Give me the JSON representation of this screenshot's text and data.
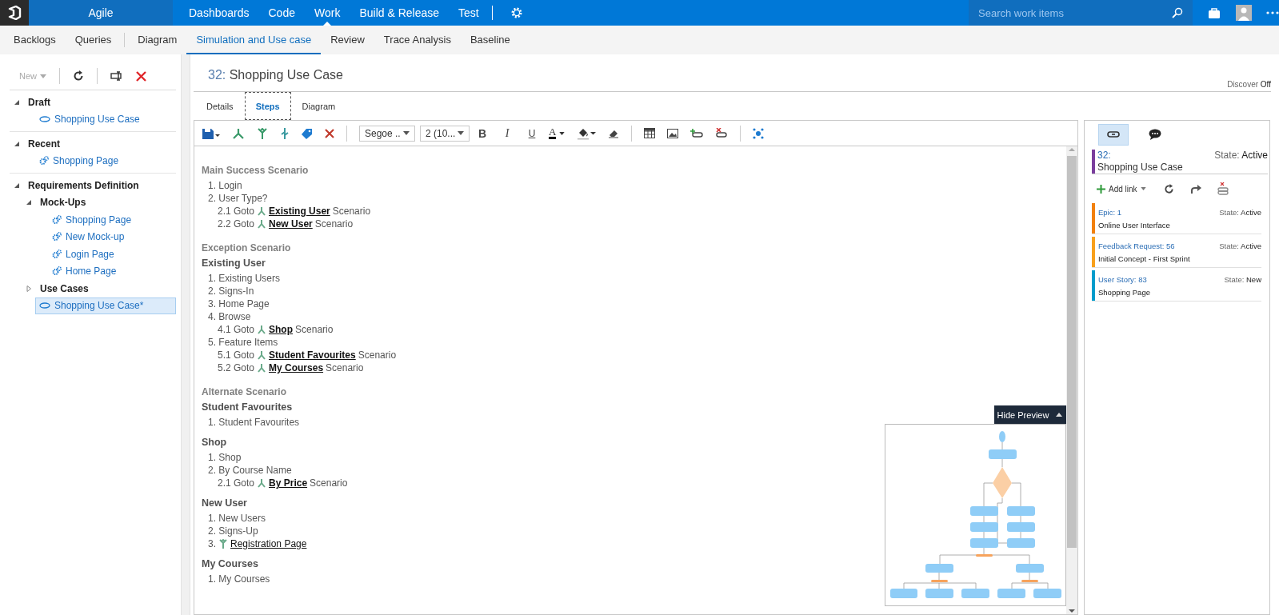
{
  "top_nav": {
    "project": "Agile",
    "items": [
      {
        "label": "Dashboards",
        "selected": false
      },
      {
        "label": "Code",
        "selected": false
      },
      {
        "label": "Work",
        "selected": true
      },
      {
        "label": "Build & Release",
        "selected": false
      },
      {
        "label": "Test",
        "selected": false
      }
    ],
    "search": {
      "placeholder": "Search work items"
    }
  },
  "sub_nav": {
    "items": [
      {
        "label": "Backlogs",
        "selected": false,
        "divider_after": false
      },
      {
        "label": "Queries",
        "selected": false,
        "divider_after": true
      },
      {
        "label": "Diagram",
        "selected": false,
        "divider_after": false
      },
      {
        "label": "Simulation and Use case",
        "selected": true,
        "divider_after": false
      },
      {
        "label": "Review",
        "selected": false,
        "divider_after": false
      },
      {
        "label": "Trace Analysis",
        "selected": false,
        "divider_after": false
      },
      {
        "label": "Baseline",
        "selected": false,
        "divider_after": false
      }
    ]
  },
  "explorer": {
    "new_button": {
      "label": "New",
      "disabled": true
    },
    "tree": [
      {
        "label": "Draft",
        "expanded": true,
        "children": [
          {
            "kind": "use-case",
            "label": "Shopping Use Case",
            "selected": false
          }
        ]
      },
      {
        "label": "Recent",
        "expanded": true,
        "children": [
          {
            "kind": "mockup",
            "label": "Shopping Page",
            "selected": false
          }
        ]
      },
      {
        "label": "Requirements Definition",
        "expanded": true,
        "children": [
          {
            "kind": "folder",
            "label": "Mock-Ups",
            "expanded": true,
            "children": [
              {
                "kind": "mockup",
                "label": "Shopping Page",
                "selected": false
              },
              {
                "kind": "mockup",
                "label": "New Mock-up",
                "selected": false
              },
              {
                "kind": "mockup",
                "label": "Login Page",
                "selected": false
              },
              {
                "kind": "mockup",
                "label": "Home Page",
                "selected": false
              }
            ]
          },
          {
            "kind": "folder",
            "label": "Use Cases",
            "expanded": false
          },
          {
            "kind": "use-case",
            "label": "Shopping Use Case*",
            "selected": true
          }
        ]
      }
    ]
  },
  "work_item": {
    "id": "32:",
    "title": "Shopping Use Case",
    "discover": {
      "label": "Discover",
      "value": "Off"
    },
    "tabs": [
      {
        "label": "Details",
        "selected": false
      },
      {
        "label": "Steps",
        "selected": true
      },
      {
        "label": "Diagram",
        "selected": false
      }
    ]
  },
  "editor": {
    "font": "Segoe ..",
    "size": "2 (10...",
    "format_buttons": [
      "B",
      "I",
      "U"
    ],
    "font_color": "A",
    "document": [
      {
        "kind": "section",
        "text": "Main Success Scenario"
      },
      {
        "kind": "step",
        "number": "1.",
        "text": "Login"
      },
      {
        "kind": "step",
        "number": "2.",
        "text": "User Type?"
      },
      {
        "kind": "goto",
        "number": "2.1",
        "prefix": "Goto",
        "link": "Existing User",
        "suffix": "Scenario"
      },
      {
        "kind": "goto",
        "number": "2.2",
        "prefix": "Goto",
        "link": "New User",
        "suffix": "Scenario"
      },
      {
        "kind": "section",
        "text": "Exception Scenario"
      },
      {
        "kind": "title",
        "text": "Existing User"
      },
      {
        "kind": "step",
        "number": "1.",
        "text": "Existing Users"
      },
      {
        "kind": "step",
        "number": "2.",
        "text": "Signs-In"
      },
      {
        "kind": "step",
        "number": "3.",
        "text": "Home Page"
      },
      {
        "kind": "step",
        "number": "4.",
        "text": "Browse"
      },
      {
        "kind": "goto",
        "number": "4.1",
        "prefix": "Goto",
        "link": "Shop",
        "suffix": "Scenario"
      },
      {
        "kind": "step",
        "number": "5.",
        "text": "Feature Items"
      },
      {
        "kind": "goto",
        "number": "5.1",
        "prefix": "Goto",
        "link": "Student Favourites",
        "suffix": "Scenario"
      },
      {
        "kind": "goto",
        "number": "5.2",
        "prefix": "Goto",
        "link": "My Courses",
        "suffix": "Scenario"
      },
      {
        "kind": "section",
        "text": "Alternate Scenario"
      },
      {
        "kind": "title",
        "text": "Student Favourites"
      },
      {
        "kind": "step",
        "number": "1.",
        "text": "Student Favourites"
      },
      {
        "kind": "title",
        "text": "Shop"
      },
      {
        "kind": "step",
        "number": "1.",
        "text": "Shop"
      },
      {
        "kind": "step",
        "number": "2.",
        "text": "By Course Name"
      },
      {
        "kind": "goto",
        "number": "2.1",
        "prefix": "Goto",
        "link": "By Price",
        "suffix": "Scenario"
      },
      {
        "kind": "title",
        "text": "New User"
      },
      {
        "kind": "step",
        "number": "1.",
        "text": "New Users"
      },
      {
        "kind": "step",
        "number": "2.",
        "text": "Signs-Up"
      },
      {
        "kind": "link",
        "number": "3.",
        "link": "Registration Page"
      },
      {
        "kind": "title",
        "text": "My Courses"
      },
      {
        "kind": "step",
        "number": "1.",
        "text": "My Courses"
      }
    ],
    "preview_button": "Hide Preview"
  },
  "links_panel": {
    "tabs": [
      {
        "kind": "links",
        "selected": true
      },
      {
        "kind": "discussion",
        "selected": false
      }
    ],
    "current": {
      "id": "32:",
      "title": "Shopping Use Case",
      "state_label": "State:",
      "state": "Active",
      "color": "#7a3e9d"
    },
    "add_link": "Add link",
    "links": [
      {
        "type": "Epic: 1",
        "title": "Online User Interface",
        "state_label": "State:",
        "state": "Active",
        "color": "#f2800d"
      },
      {
        "type": "Feedback Request: 56",
        "title": "Initial Concept - First Sprint",
        "state_label": "State:",
        "state": "Active",
        "color": "#f8a01c"
      },
      {
        "type": "User Story: 83",
        "title": "Shopping Page",
        "state_label": "State:",
        "state": "New",
        "color": "#009ccc"
      }
    ]
  }
}
